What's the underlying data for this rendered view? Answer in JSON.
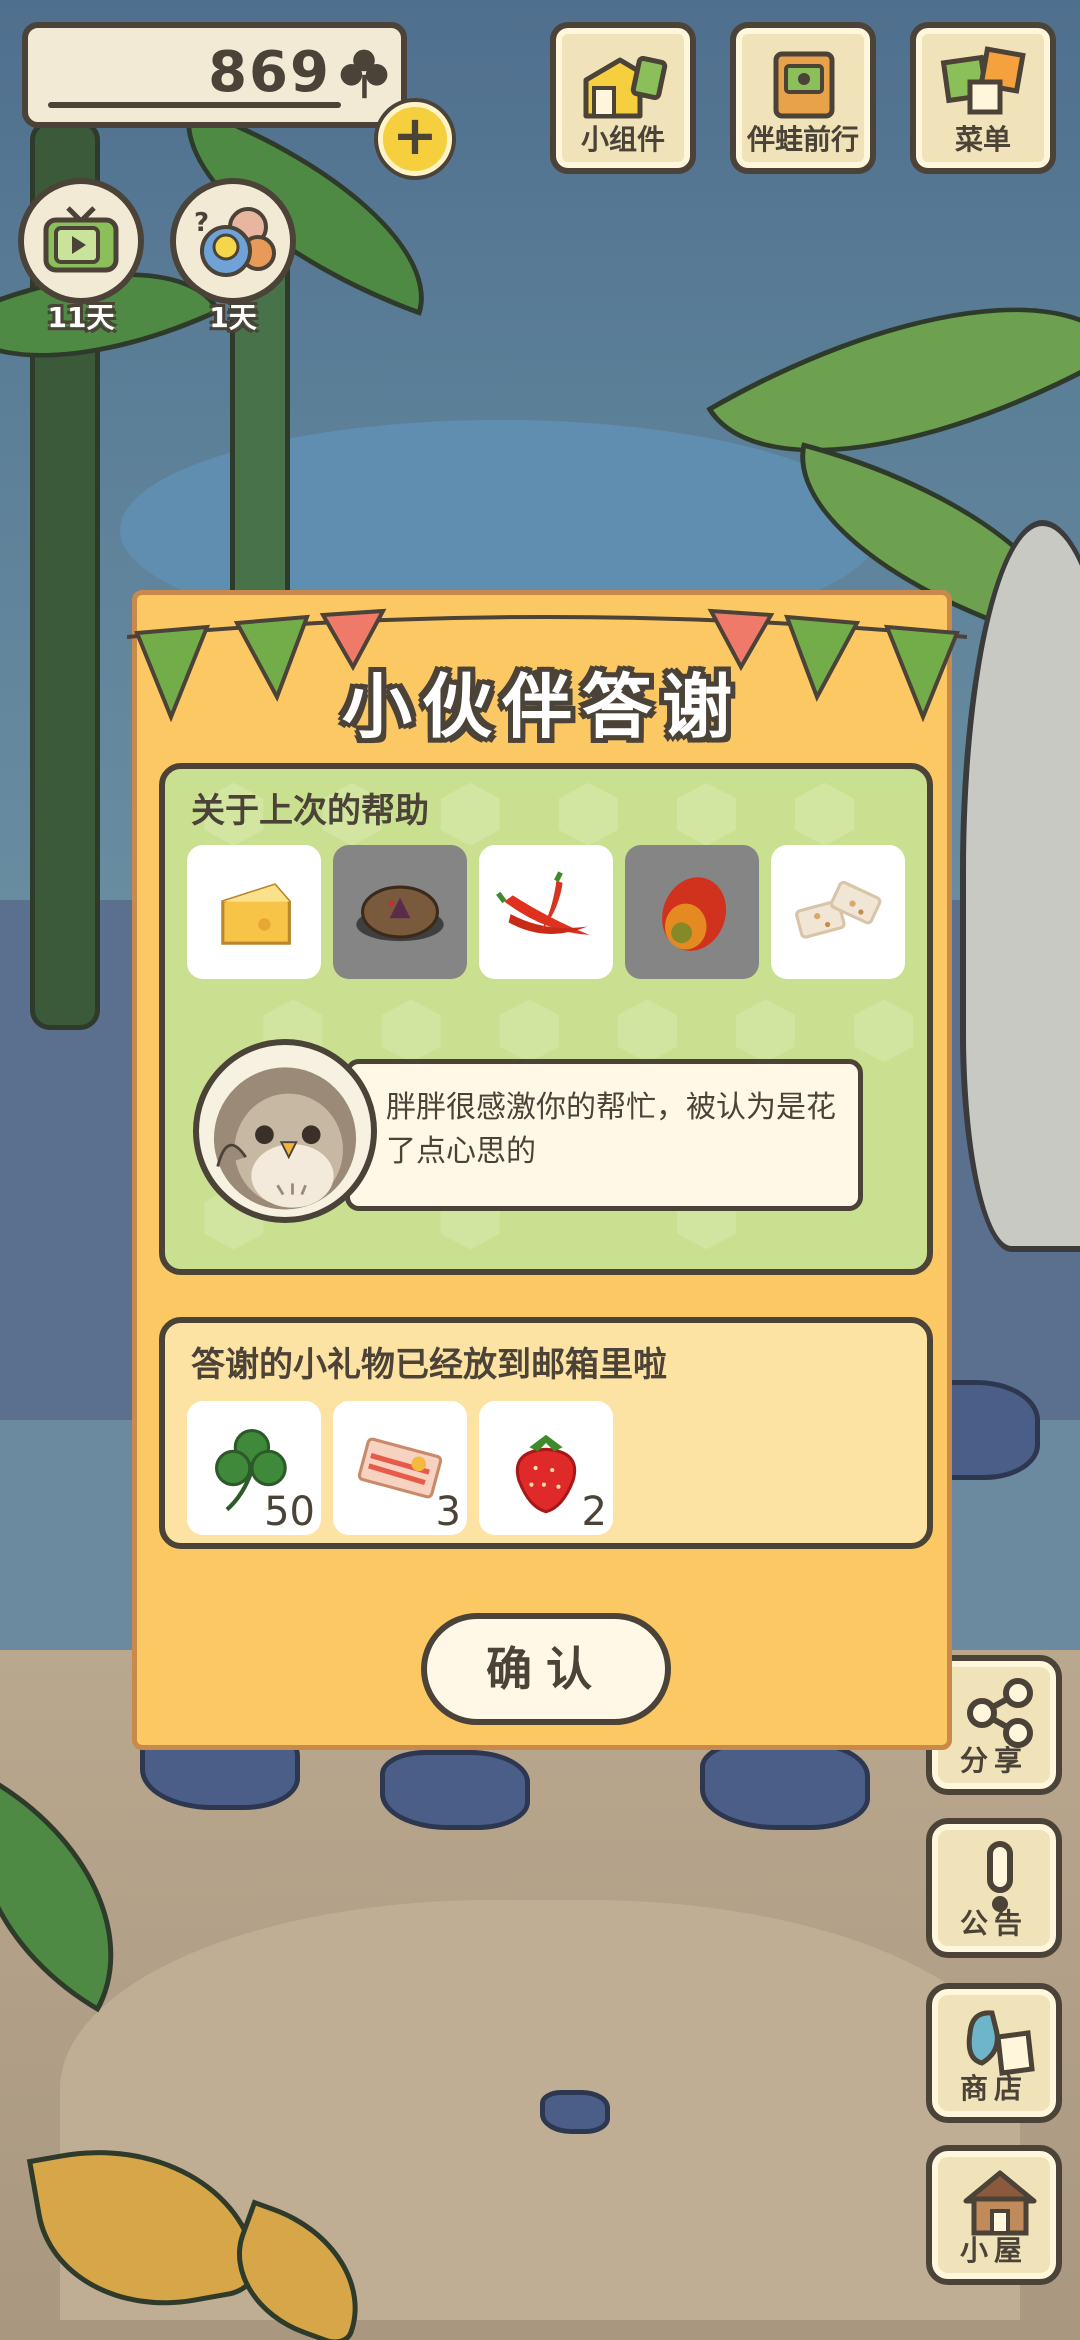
{
  "hud": {
    "clover_count": "869",
    "tv_days": "11天",
    "friends_days": "1天",
    "top_buttons": [
      {
        "label": "小组件",
        "icon": "widget-icon"
      },
      {
        "label": "伴蛙前行",
        "icon": "album-icon"
      },
      {
        "label": "菜单",
        "icon": "menu-icon"
      }
    ]
  },
  "side_buttons": [
    {
      "label": "分享",
      "icon": "share-icon"
    },
    {
      "label": "公告",
      "icon": "notice-icon"
    },
    {
      "label": "商店",
      "icon": "shop-icon"
    },
    {
      "label": "小屋",
      "icon": "house-icon"
    }
  ],
  "dialog": {
    "title": "小伙伴答谢",
    "help_section_title": "关于上次的帮助",
    "help_items": [
      {
        "name": "cheese",
        "highlighted": false
      },
      {
        "name": "mooncake",
        "highlighted": true
      },
      {
        "name": "chili-peppers",
        "highlighted": false
      },
      {
        "name": "mango",
        "highlighted": true
      },
      {
        "name": "nougat",
        "highlighted": false
      }
    ],
    "message": "胖胖很感激你的帮忙，被认为是花了点心思的",
    "gift_section_title": "答谢的小礼物已经放到邮箱里啦",
    "gifts": [
      {
        "name": "clover",
        "count": "50"
      },
      {
        "name": "ticket",
        "count": "3"
      },
      {
        "name": "strawberry",
        "count": "2"
      }
    ],
    "confirm_label": "确认"
  },
  "colors": {
    "dialog_bg": "#fcc864",
    "green_panel": "#c8e08f",
    "outline": "#4b4238"
  }
}
